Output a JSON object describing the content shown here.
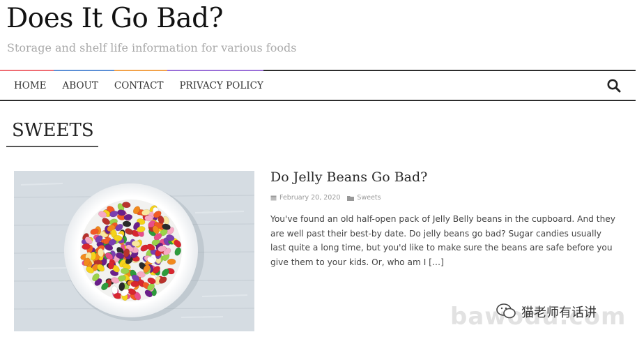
{
  "site": {
    "title": "Does It Go Bad?",
    "tagline": "Storage and shelf life information for various foods"
  },
  "nav": {
    "items": [
      {
        "label": "HOME"
      },
      {
        "label": "ABOUT"
      },
      {
        "label": "CONTACT"
      },
      {
        "label": "PRIVACY POLICY"
      }
    ],
    "search_icon": "search-icon"
  },
  "accent_colors": [
    "#ef6c73",
    "#5b8fd6",
    "#f2a24a",
    "#9a6fd8"
  ],
  "category": {
    "title": "SWEETS"
  },
  "post": {
    "title": "Do Jelly Beans Go Bad?",
    "date": "February 20, 2020",
    "category": "Sweets",
    "excerpt": "You've found an old half-open pack of Jelly Belly beans in the cupboard. And they are well past their best-by date. Do jelly beans go bad? Sugar candies usually last quite a long time, but you'd like to make sure the beans are safe before you give them to your kids. Or, who am I […]",
    "thumbnail": "bowl of colorful jelly beans"
  },
  "watermark": {
    "label": "猫老师有话讲",
    "text": "bawodu.com"
  }
}
